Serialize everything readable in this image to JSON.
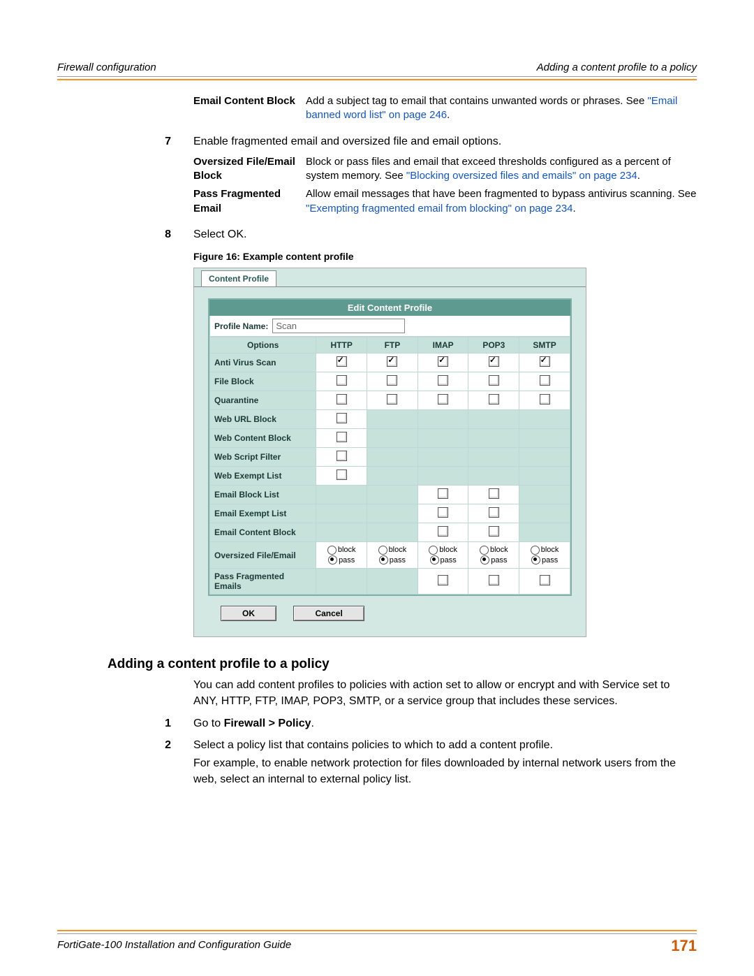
{
  "header": {
    "left": "Firewall configuration",
    "right": "Adding a content profile to a policy"
  },
  "defs1": {
    "ecb_label": "Email Content Block",
    "ecb_desc": "Add a subject tag to email that contains unwanted words or phrases. See ",
    "ecb_link": "\"Email banned word list\" on page 246",
    "ecb_tail": "."
  },
  "step7": {
    "num": "7",
    "text": "Enable fragmented email and oversized file and email options."
  },
  "defs2": {
    "ofe_label": "Oversized File/Email Block",
    "ofe_desc": "Block or pass files and email that exceed thresholds configured as a percent of system memory. See ",
    "ofe_link": "\"Blocking oversized files and emails\" on page 234",
    "ofe_tail": ".",
    "pfe_label": "Pass Fragmented Email",
    "pfe_desc": "Allow email messages that have been fragmented to bypass antivirus scanning. See ",
    "pfe_link": "\"Exempting fragmented email from blocking\" on page 234",
    "pfe_tail": "."
  },
  "step8": {
    "num": "8",
    "text": "Select OK."
  },
  "figcap": "Figure 16: Example content profile",
  "profile": {
    "tab": "Content Profile",
    "edit_title": "Edit Content Profile",
    "name_label": "Profile Name:",
    "name_value": "Scan",
    "cols": {
      "opt": "Options",
      "http": "HTTP",
      "ftp": "FTP",
      "imap": "IMAP",
      "pop3": "POP3",
      "smtp": "SMTP"
    },
    "rows": {
      "avs": "Anti Virus Scan",
      "fb": "File Block",
      "qr": "Quarantine",
      "wub": "Web URL Block",
      "wcb": "Web Content Block",
      "wsf": "Web Script Filter",
      "wel": "Web Exempt List",
      "ebl": "Email Block List",
      "eel": "Email Exempt List",
      "ecb": "Email Content Block",
      "ofe": "Oversized File/Email",
      "pfe": "Pass Fragmented Emails"
    },
    "radio_block": "block",
    "radio_pass": "pass",
    "ok": "OK",
    "cancel": "Cancel"
  },
  "section_title": "Adding a content profile to a policy",
  "para1": "You can add content profiles to policies with action set to allow or encrypt and with Service set to ANY, HTTP, FTP, IMAP, POP3, SMTP, or a service group that includes these services.",
  "step_a": {
    "num": "1",
    "pre": "Go to ",
    "bold": "Firewall > Policy",
    "post": "."
  },
  "step_b": {
    "num": "2",
    "text": "Select a policy list that contains policies to which to add a content profile."
  },
  "para2": "For example, to enable network protection for files downloaded by internal network users from the web, select an internal to external policy list.",
  "footer": {
    "left": "FortiGate-100 Installation and Configuration Guide",
    "right": "171"
  }
}
